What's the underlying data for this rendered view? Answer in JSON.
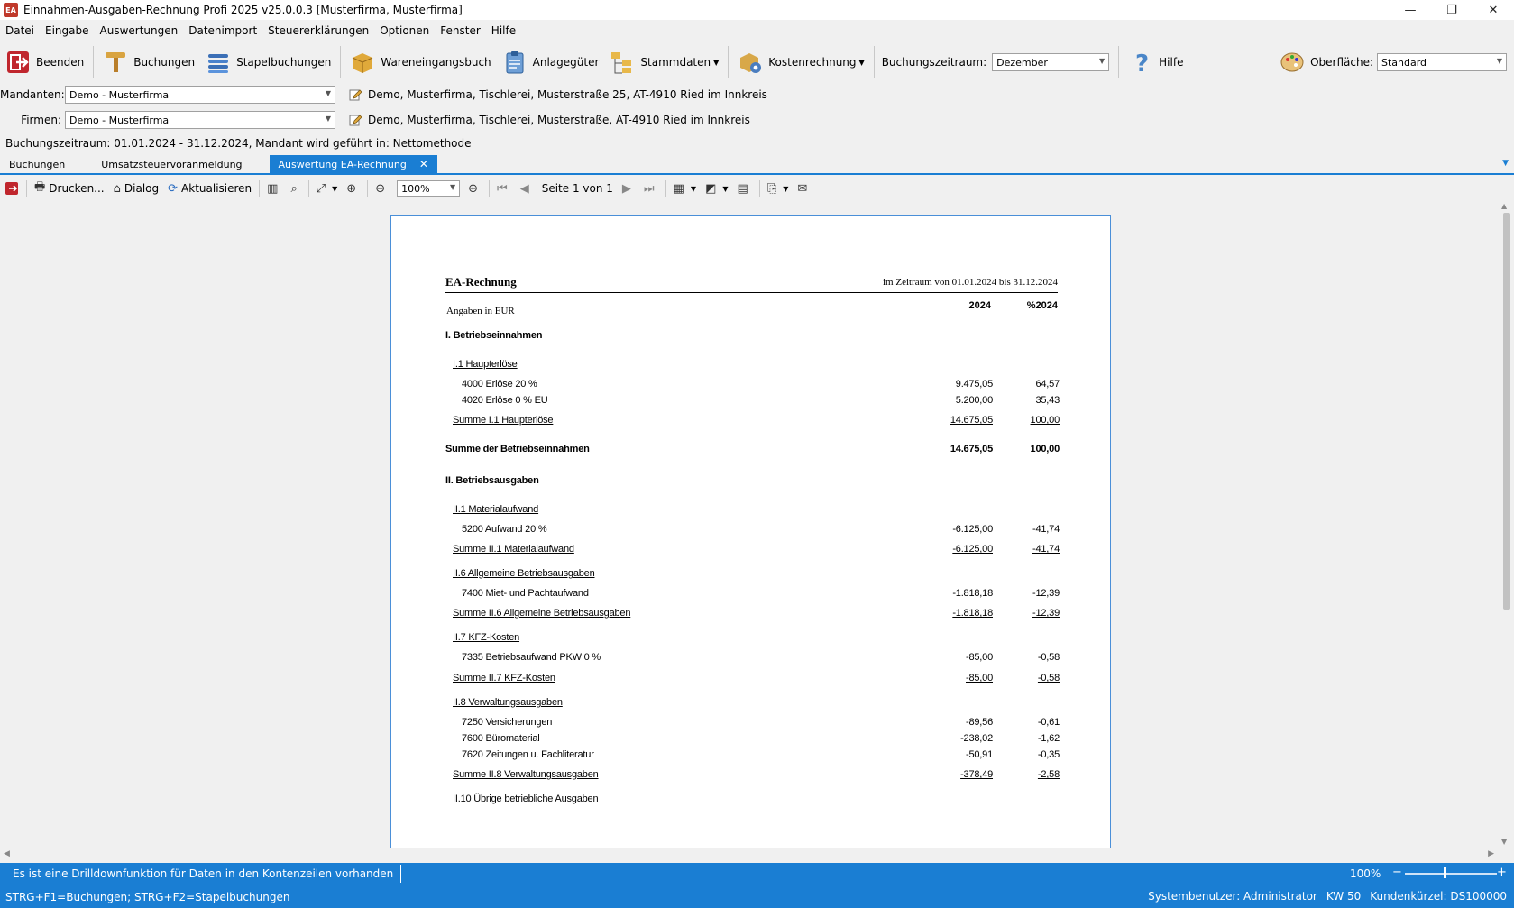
{
  "window": {
    "title": "Einnahmen-Ausgaben-Rechnung Profi 2025 v25.0.0.3 [Musterfirma, Musterfirma]",
    "icon_label": "EA",
    "controls": [
      "—",
      "❐",
      "✕"
    ]
  },
  "menu": [
    "Datei",
    "Eingabe",
    "Auswertungen",
    "Datenimport",
    "Steuererklärungen",
    "Optionen",
    "Fenster",
    "Hilfe"
  ],
  "toolbar": {
    "beenden": "Beenden",
    "buchungen": "Buchungen",
    "stapelbuchungen": "Stapelbuchungen",
    "wareneingangsbuch": "Wareneingangsbuch",
    "anlagegueter": "Anlagegüter",
    "stammdaten": "Stammdaten",
    "kostenrechnung": "Kostenrechnung",
    "buchungszeitraum_label": "Buchungszeitraum:",
    "buchungszeitraum_value": "Dezember",
    "hilfe": "Hilfe",
    "oberflaeche_label": "Oberfläche:",
    "oberflaeche_value": "Standard"
  },
  "mandanten": {
    "label": "Mandanten:",
    "value": "Demo - Musterfirma",
    "info": "Demo, Musterfirma, Tischlerei, Musterstraße 25, AT-4910 Ried im Innkreis"
  },
  "firmen": {
    "label": "Firmen:",
    "value": "Demo - Musterfirma",
    "info": "Demo, Musterfirma, Tischlerei, Musterstraße, AT-4910 Ried im Innkreis"
  },
  "period_info": "Buchungszeitraum: 01.01.2024 - 31.12.2024, Mandant wird geführt in:  Nettomethode",
  "tabs": [
    "Buchungen",
    "Umsatzsteuervoranmeldung",
    "Auswertung EA-Rechnung"
  ],
  "report_toolbar": {
    "print": "Drucken...",
    "dialog": "Dialog",
    "refresh": "Aktualisieren",
    "zoom": "100%",
    "page": "Seite 1 von 1"
  },
  "report": {
    "title": "EA-Rechnung",
    "period": "im Zeitraum von 01.01.2024 bis 31.12.2024",
    "units": "Angaben in EUR",
    "col1": "2024",
    "col2": "%2024",
    "lines": [
      {
        "label": "I. Betriebseinnahmen",
        "v1": "",
        "v2": "",
        "style": "section"
      },
      {
        "label": "I.1 Haupterlöse",
        "v1": "",
        "v2": "",
        "style": "group"
      },
      {
        "label": "4000 Erlöse 20 %",
        "v1": "9.475,05",
        "v2": "64,57",
        "style": "account"
      },
      {
        "label": "4020 Erlöse 0 % EU",
        "v1": "5.200,00",
        "v2": "35,43",
        "style": "account"
      },
      {
        "label": "Summe I.1 Haupterlöse",
        "v1": "14.675,05",
        "v2": "100,00",
        "style": "sum"
      },
      {
        "label": "Summe der Betriebseinnahmen",
        "v1": "14.675,05",
        "v2": "100,00",
        "style": "total"
      },
      {
        "label": "II. Betriebsausgaben",
        "v1": "",
        "v2": "",
        "style": "section"
      },
      {
        "label": "II.1 Materialaufwand",
        "v1": "",
        "v2": "",
        "style": "group"
      },
      {
        "label": "5200 Aufwand 20 %",
        "v1": "-6.125,00",
        "v2": "-41,74",
        "style": "account"
      },
      {
        "label": "Summe II.1 Materialaufwand",
        "v1": "-6.125,00",
        "v2": "-41,74",
        "style": "sum"
      },
      {
        "label": "II.6 Allgemeine Betriebsausgaben",
        "v1": "",
        "v2": "",
        "style": "group"
      },
      {
        "label": "7400 Miet- und Pachtaufwand",
        "v1": "-1.818,18",
        "v2": "-12,39",
        "style": "account"
      },
      {
        "label": "Summe II.6 Allgemeine Betriebsausgaben",
        "v1": "-1.818,18",
        "v2": "-12,39",
        "style": "sum"
      },
      {
        "label": "II.7 KFZ-Kosten",
        "v1": "",
        "v2": "",
        "style": "group"
      },
      {
        "label": "7335 Betriebsaufwand PKW 0 %",
        "v1": "-85,00",
        "v2": "-0,58",
        "style": "account"
      },
      {
        "label": "Summe II.7 KFZ-Kosten",
        "v1": "-85,00",
        "v2": "-0,58",
        "style": "sum"
      },
      {
        "label": "II.8 Verwaltungsausgaben",
        "v1": "",
        "v2": "",
        "style": "group"
      },
      {
        "label": "7250 Versicherungen",
        "v1": "-89,56",
        "v2": "-0,61",
        "style": "account"
      },
      {
        "label": "7600 Büromaterial",
        "v1": "-238,02",
        "v2": "-1,62",
        "style": "account"
      },
      {
        "label": "7620 Zeitungen u. Fachliteratur",
        "v1": "-50,91",
        "v2": "-0,35",
        "style": "account"
      },
      {
        "label": "Summe II.8 Verwaltungsausgaben",
        "v1": "-378,49",
        "v2": "-2,58",
        "style": "sum"
      },
      {
        "label": "II.10 Übrige betriebliche Ausgaben",
        "v1": "",
        "v2": "",
        "style": "group"
      }
    ]
  },
  "status": {
    "message": "Es ist eine Drilldownfunktion für Daten in den Kontenzeilen vorhanden",
    "zoom": "100%",
    "zoom_minus": "−",
    "zoom_plus": "+",
    "shortcuts": "STRG+F1=Buchungen; STRG+F2=Stapelbuchungen",
    "user": "Systembenutzer: Administrator",
    "week": "KW 50",
    "customer": "Kundenkürzel: DS100000"
  },
  "colors": {
    "accent": "#1a7ed3",
    "page_border": "#4a8fd8"
  }
}
